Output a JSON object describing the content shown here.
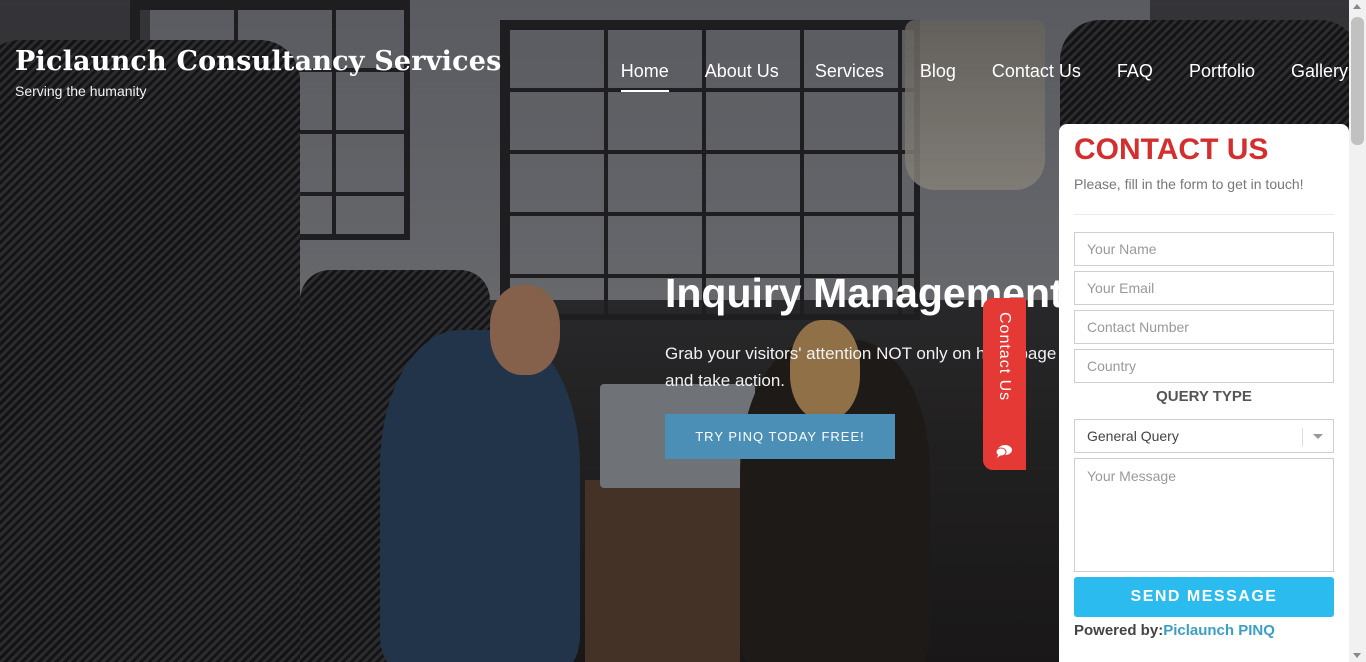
{
  "brand": {
    "title": "Piclaunch Consultancy Services",
    "tagline": "Serving the humanity"
  },
  "nav": {
    "items": [
      {
        "label": "Home",
        "active": true
      },
      {
        "label": "About Us"
      },
      {
        "label": "Services"
      },
      {
        "label": "Blog"
      },
      {
        "label": "Contact Us"
      },
      {
        "label": "FAQ"
      },
      {
        "label": "Portfolio"
      },
      {
        "label": "Gallery"
      }
    ]
  },
  "hero": {
    "title": "Inquiry Management",
    "subtitle": "Grab your visitors' attention NOT only on homepage and take action.",
    "cta_label": "TRY PINQ TODAY FREE!"
  },
  "side_tab": {
    "label": "Contact Us",
    "icon": "chat-bubbles-icon"
  },
  "contact_form": {
    "heading": "CONTACT US",
    "subheading": "Please, fill in the form to get in touch!",
    "name_placeholder": "Your Name",
    "email_placeholder": "Your Email",
    "phone_placeholder": "Contact Number",
    "country_placeholder": "Country",
    "query_type_label": "QUERY TYPE",
    "query_type_value": "General Query",
    "message_placeholder": "Your Message",
    "send_label": "SEND MESSAGE",
    "powered_by_label": "Powered by:",
    "powered_by_link": "Piclaunch PINQ"
  },
  "colors": {
    "accent_red": "#d32f2f",
    "tab_red": "#e53935",
    "send_blue": "#2bbbee",
    "cta_blue": "#4b8fb6"
  }
}
